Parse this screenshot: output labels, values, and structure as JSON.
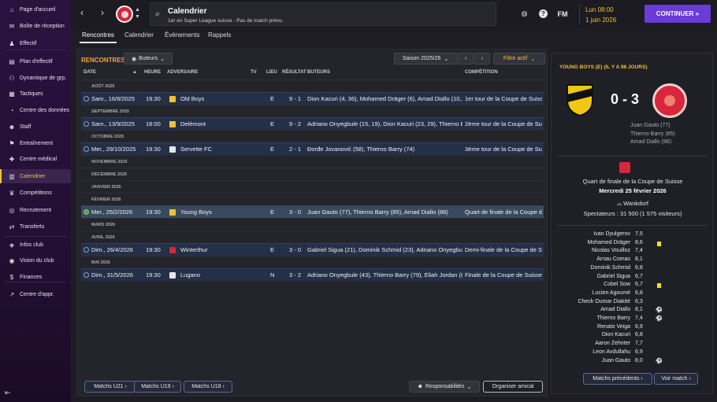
{
  "sidebar": {
    "items": [
      {
        "label": "Page d'accueil",
        "icon": "home-icon",
        "glyph": "⌂"
      },
      {
        "label": "Boîte de réception",
        "icon": "inbox-icon",
        "glyph": "✉"
      },
      {
        "label": "Effectif",
        "icon": "squad-icon",
        "glyph": "♟"
      },
      {
        "label": "Plan d'effectif",
        "icon": "squad-plan-icon",
        "glyph": "▤"
      },
      {
        "label": "Dynamique de grp.",
        "icon": "dynamics-icon",
        "glyph": "⚇"
      },
      {
        "label": "Tactiques",
        "icon": "tactics-icon",
        "glyph": "▦"
      },
      {
        "label": "Centre des données",
        "icon": "data-hub-icon",
        "glyph": "◔"
      },
      {
        "label": "Staff",
        "icon": "staff-icon",
        "glyph": "☻"
      },
      {
        "label": "Entraînement",
        "icon": "training-icon",
        "glyph": "⚑"
      },
      {
        "label": "Centre médical",
        "icon": "medical-icon",
        "glyph": "✚"
      },
      {
        "label": "Calendrier",
        "icon": "calendar-icon",
        "glyph": "▥"
      },
      {
        "label": "Compétitions",
        "icon": "trophy-icon",
        "glyph": "♛"
      },
      {
        "label": "Recrutement",
        "icon": "scouting-icon",
        "glyph": "◎"
      },
      {
        "label": "Transferts",
        "icon": "transfers-icon",
        "glyph": "⇄"
      },
      {
        "label": "Infos club",
        "icon": "club-info-icon",
        "glyph": "◈"
      },
      {
        "label": "Vision du club",
        "icon": "club-vision-icon",
        "glyph": "◉"
      },
      {
        "label": "Finances",
        "icon": "finances-icon",
        "glyph": "$"
      },
      {
        "label": "Centre d'appr.",
        "icon": "development-icon",
        "glyph": "↗"
      }
    ],
    "active_index": 10
  },
  "topbar": {
    "title": "Calendrier",
    "subtitle": "1er en Super League suisse - Pas de match prévu.",
    "date_time": "Lun 08:00",
    "date": "1 juin 2026",
    "fm_label": "FM",
    "help_label": "?",
    "continue_label": "CONTINUER »"
  },
  "tabs": [
    "Rencontres",
    "Calendrier",
    "Évènements",
    "Rappels"
  ],
  "main": {
    "section_title": "RENCONTRES",
    "filter_button": "Buteurs",
    "season_select": "Saison 2025/26",
    "active_filter": "Filtre actif",
    "columns": [
      "DATE",
      "HEURE",
      "ADVERSAIRE",
      "TV",
      "LIEU",
      "RÉSULTAT",
      "BUTEURS",
      "COMPÉTITION"
    ],
    "months": [
      "AOÛT 2025",
      "SEPTEMBRE 2025",
      "OCTOBRE 2025",
      "NOVEMBRE 2025",
      "DÉCEMBRE 2025",
      "JANVIER 2026",
      "FÉVRIER 2026",
      "MARS 2026",
      "AVRIL 2026",
      "MAI 2026"
    ],
    "matches": [
      {
        "date": "Sam., 16/8/2025",
        "time": "19:30",
        "opponent": "Old Boys",
        "crest": "#f0c03a",
        "venue": "E",
        "result": "9 - 1",
        "scorers": "Dion Kacuri (4, 36), Mohamed Dräger (6), Amad Diallo (10,...",
        "competition": "1er tour de la Coupe de Suisse"
      },
      {
        "date": "Sam., 13/9/2025",
        "time": "18:00",
        "opponent": "Delémont",
        "crest": "#f0c03a",
        "venue": "E",
        "result": "9 - 2",
        "scorers": "Adriano Onyegbule (15, 19), Dion Kacuri (23, 29), Thierno Ba...",
        "competition": "2ème tour de la Coupe de Suisse"
      },
      {
        "date": "Mer., 29/10/2025",
        "time": "19:30",
        "opponent": "Servette FC",
        "crest": "#e6e6e6",
        "venue": "E",
        "result": "2 - 1",
        "scorers": "Đorđe Jovanović (58), Thierno Barry (74)",
        "competition": "3ème tour de la Coupe de Suisse"
      },
      {
        "date": "Mer., 25/2/2026",
        "time": "19:30",
        "opponent": "Young Boys",
        "crest": "#f0c03a",
        "venue": "E",
        "result": "3 - 0",
        "scorers": "Juan Gauto (77), Thierno Barry (85), Amad Diallo (88)",
        "competition": "Quart de finale de la Coupe de..."
      },
      {
        "date": "Dim., 26/4/2026",
        "time": "19:30",
        "opponent": "Winterthur",
        "crest": "#d7263d",
        "venue": "E",
        "result": "3 - 0",
        "scorers": "Gabriel Sigua (21), Dominik Schmid (23), Adriano Onyegbul...",
        "competition": "Demi-finale de la Coupe de Suisse"
      },
      {
        "date": "Dim., 31/5/2026",
        "time": "19:30",
        "opponent": "Lugano",
        "crest": "#e6e6e6",
        "venue": "N",
        "result": "3 - 2",
        "scorers": "Adriano Onyegbule (43), Thierno Barry (79), Eliah Jordan (8...",
        "competition": "Finale de la Coupe de Suisse"
      }
    ],
    "bottom_buttons": [
      "Matchs U21 ›",
      "Matchs U19 ›",
      "Matchs U18 ›"
    ],
    "responsibilities": "Responsabilités",
    "friendly": "Organiser amical"
  },
  "panel": {
    "title": "YOUNG BOYS (E) (IL Y A 98 JOURS)",
    "score": "0 - 3",
    "scorers": [
      "Juan Gauto (77)",
      "Thierno Barry (85)",
      "Amad Diallo (88)"
    ],
    "competition": "Quart de finale de la Coupe de Suisse",
    "match_date": "Mercredi 25 février 2026",
    "stadium": "Wankdorf",
    "attendance": "Spectateurs : 31 500 (1 575 visiteurs)",
    "players": [
      {
        "name": "Ivan Dyulgerov",
        "rating": "7,5",
        "event": ""
      },
      {
        "name": "Mohamed Dräger",
        "rating": "8,6",
        "event": "card"
      },
      {
        "name": "Nicolas Vouilloz",
        "rating": "7,4",
        "event": ""
      },
      {
        "name": "Arnau Comas",
        "rating": "8,1",
        "event": ""
      },
      {
        "name": "Dominik Schmid",
        "rating": "6,8",
        "event": ""
      },
      {
        "name": "Gabriel Sigua",
        "rating": "6,7",
        "event": ""
      },
      {
        "name": "Cobel Sow",
        "rating": "6,7",
        "event": "card"
      },
      {
        "name": "Lucien Agoumé",
        "rating": "6,8",
        "event": ""
      },
      {
        "name": "Check Oumar Diakité",
        "rating": "6,3",
        "event": ""
      },
      {
        "name": "Amad Diallo",
        "rating": "8,1",
        "event": "goal"
      },
      {
        "name": "Thierno Barry",
        "rating": "7,4",
        "event": "goal"
      },
      {
        "name": "Renato Veiga",
        "rating": "6,9",
        "event": ""
      },
      {
        "name": "Dion Kacuri",
        "rating": "6,8",
        "event": ""
      },
      {
        "name": "Aaron Zehnter",
        "rating": "7,7",
        "event": ""
      },
      {
        "name": "Leon Avdullahu",
        "rating": "6,9",
        "event": ""
      },
      {
        "name": "Juan Gauto",
        "rating": "8,0",
        "event": "goal"
      }
    ],
    "prev_matches": "Matchs précédents ›",
    "view_match": "Voir match ›"
  }
}
